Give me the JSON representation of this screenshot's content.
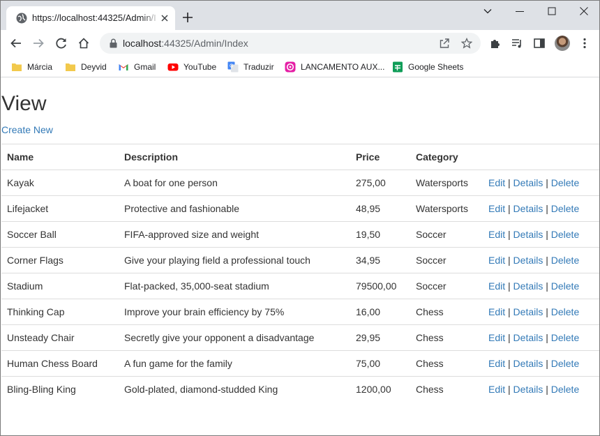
{
  "browser": {
    "tab_title": "https://localhost:44325/Admin/In",
    "url_host": "localhost",
    "url_path": ":44325/Admin/Index"
  },
  "bookmarks": [
    {
      "label": "Márcia",
      "icon": "folder-icon"
    },
    {
      "label": "Deyvid",
      "icon": "folder-icon"
    },
    {
      "label": "Gmail",
      "icon": "gmail-icon"
    },
    {
      "label": "YouTube",
      "icon": "youtube-icon"
    },
    {
      "label": "Traduzir",
      "icon": "translate-icon"
    },
    {
      "label": "LANCAMENTO AUX...",
      "icon": "app-icon"
    },
    {
      "label": "Google Sheets",
      "icon": "sheets-icon"
    }
  ],
  "page": {
    "title": "View",
    "create_link": "Create New",
    "columns": [
      "Name",
      "Description",
      "Price",
      "Category"
    ],
    "actions": {
      "edit": "Edit",
      "details": "Details",
      "delete": "Delete",
      "separator": "|"
    },
    "rows": [
      {
        "name": "Kayak",
        "description": "A boat for one person",
        "price": "275,00",
        "category": "Watersports"
      },
      {
        "name": "Lifejacket",
        "description": "Protective and fashionable",
        "price": "48,95",
        "category": "Watersports"
      },
      {
        "name": "Soccer Ball",
        "description": "FIFA-approved size and weight",
        "price": "19,50",
        "category": "Soccer"
      },
      {
        "name": "Corner Flags",
        "description": "Give your playing field a professional touch",
        "price": "34,95",
        "category": "Soccer"
      },
      {
        "name": "Stadium",
        "description": "Flat-packed, 35,000-seat stadium",
        "price": "79500,00",
        "category": "Soccer"
      },
      {
        "name": "Thinking Cap",
        "description": "Improve your brain efficiency by 75%",
        "price": "16,00",
        "category": "Chess"
      },
      {
        "name": "Unsteady Chair",
        "description": "Secretly give your opponent a disadvantage",
        "price": "29,95",
        "category": "Chess"
      },
      {
        "name": "Human Chess Board",
        "description": "A fun game for the family",
        "price": "75,00",
        "category": "Chess"
      },
      {
        "name": "Bling-Bling King",
        "description": "Gold-plated, diamond-studded King",
        "price": "1200,00",
        "category": "Chess"
      }
    ]
  },
  "colors": {
    "link": "#337ab7",
    "text": "#333333",
    "tabstrip": "#dee1e6",
    "omnibox": "#f1f3f4"
  }
}
